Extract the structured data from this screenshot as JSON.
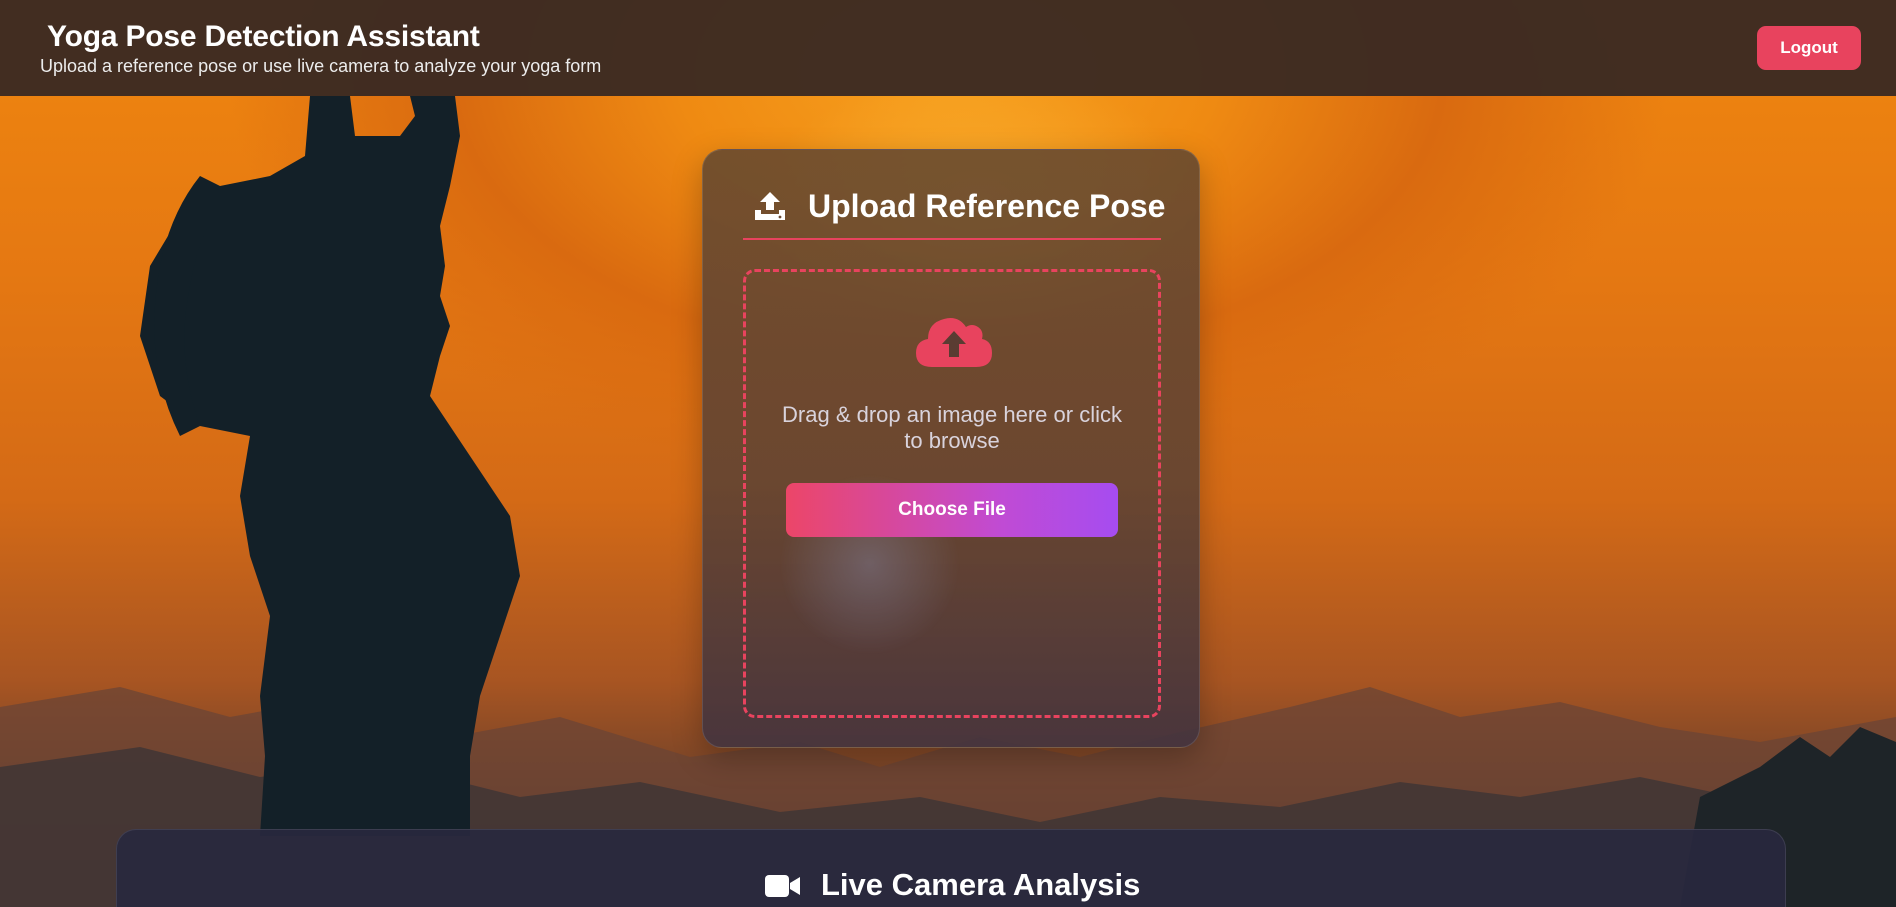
{
  "header": {
    "title": "Yoga Pose Detection Assistant",
    "subtitle": "Upload a reference pose or use live camera to analyze your yoga form",
    "logout_label": "Logout"
  },
  "upload": {
    "heading": "Upload Reference Pose",
    "heading_icon": "upload-icon",
    "dropzone_icon": "cloud-upload-icon",
    "dropzone_text": "Drag & drop an image here or click to browse",
    "choose_file_label": "Choose File"
  },
  "camera": {
    "heading": "Live Camera Analysis",
    "heading_icon": "video-camera-icon"
  },
  "colors": {
    "accent": "#e8435e",
    "button_gradient_start": "#ec4668",
    "button_gradient_end": "#a64cf0",
    "header_bg": "#3a2a22"
  }
}
